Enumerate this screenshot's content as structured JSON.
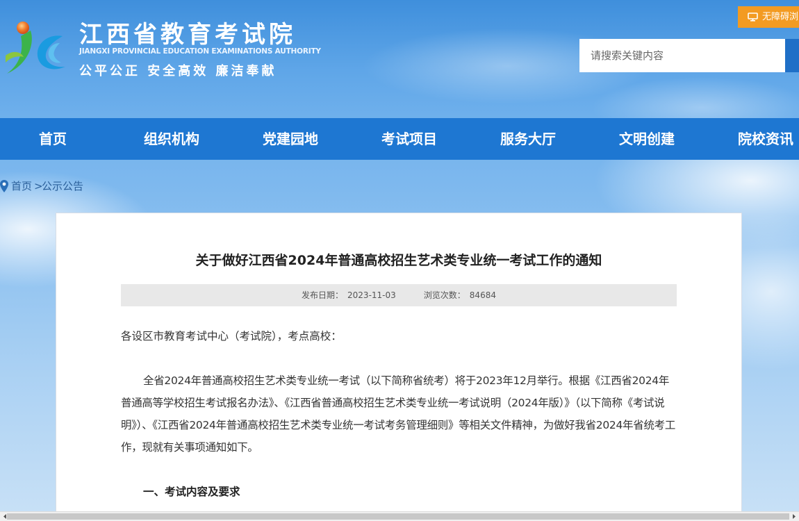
{
  "header": {
    "site_title": "江西省教育考试院",
    "site_subtitle": "JIANGXI PROVINCIAL EDUCATION EXAMINATIONS AUTHORITY",
    "site_motto": "公平公正  安全高效  廉洁奉献",
    "accessibility_label": "无障碍浏览",
    "search_placeholder": "请搜索关键内容"
  },
  "nav": {
    "items": [
      "首页",
      "组织机构",
      "党建园地",
      "考试项目",
      "服务大厅",
      "文明创建",
      "院校资讯"
    ]
  },
  "breadcrumb": {
    "home": "首页",
    "separator": ">",
    "current": "公示公告"
  },
  "article": {
    "title": "关于做好江西省2024年普通高校招生艺术类专业统一考试工作的通知",
    "publish_label": "发布日期：",
    "publish_date": "2023-11-03",
    "views_label": "浏览次数：",
    "views_count": "84684",
    "greeting": "各设区市教育考试中心（考试院），考点高校：",
    "paragraph_1": "全省2024年普通高校招生艺术类专业统一考试（以下简称省统考）将于2023年12月举行。根据《江西省2024年普通高等学校招生考试报名办法》、《江西省普通高校招生艺术类专业统一考试说明（2024年版）》（以下简称《考试说明》）、《江西省2024年普通高校招生艺术类专业统一考试考务管理细则》等相关文件精神，为做好我省2024年省统考工作，现就有关事项通知如下。",
    "section_1_heading": "一、考试内容及要求"
  },
  "colors": {
    "nav_bg": "#1e77d2",
    "accessibility_bg": "#f39b22",
    "search_button": "#1f6fc7",
    "breadcrumb_text": "#2a5f9a"
  },
  "icons": {
    "accessibility": "monitor-icon",
    "breadcrumb": "location-pin-icon",
    "logo": "jx-logo-icon"
  }
}
